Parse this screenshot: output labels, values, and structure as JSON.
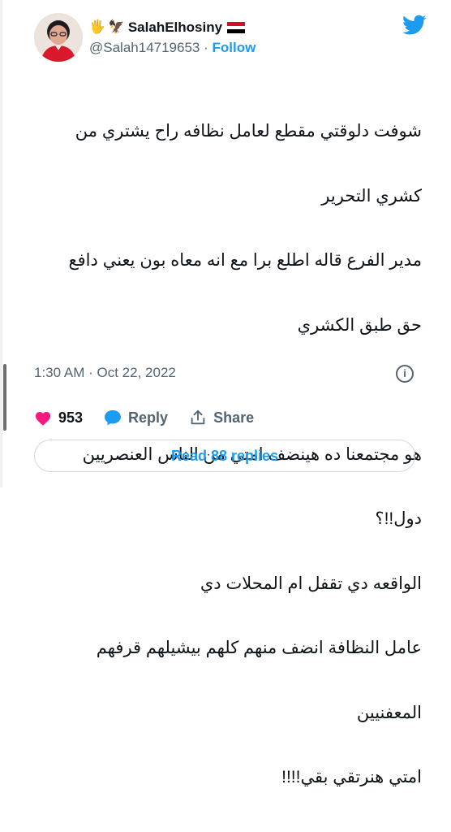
{
  "author": {
    "display_name": "SalahElhosiny",
    "handle": "@Salah14719653",
    "separator": "·",
    "follow_label": "Follow",
    "emoji_hand": "🖐",
    "emoji_eagle": "🦅"
  },
  "tweet": {
    "lines": [
      "شوفت دلوقتي مقطع لعامل نظافه راح يشتري من",
      "كشري التحرير",
      "مدير الفرع قاله اطلع برا مع انه معاه بون يعني دافع",
      "حق طبق الكشري",
      "",
      "هو مجتمعنا ده هينضف امتي من الناس العنصريين",
      "دول!!؟",
      "الواقعه دي تقفل ام المحلات دي",
      "عامل النظافة انضف منهم كلهم بيشيلهم قرفهم",
      "المعفنيين",
      "امتي هنرتقي بقي!!!!"
    ],
    "time": "1:30 AM",
    "date_separator": "·",
    "date": "Oct 22, 2022",
    "info_icon_glyph": "i"
  },
  "actions": {
    "like_count": "953",
    "reply_label": "Reply",
    "share_label": "Share"
  },
  "read_replies_label": "Read 88 replies",
  "colors": {
    "accent": "#1d9bf0",
    "like": "#f91880",
    "muted": "#536471",
    "text": "#0f1419",
    "border": "#cfd9de"
  },
  "icons": [
    "twitter-bird-icon",
    "info-icon",
    "heart-icon",
    "reply-bubble-icon",
    "share-icon"
  ]
}
